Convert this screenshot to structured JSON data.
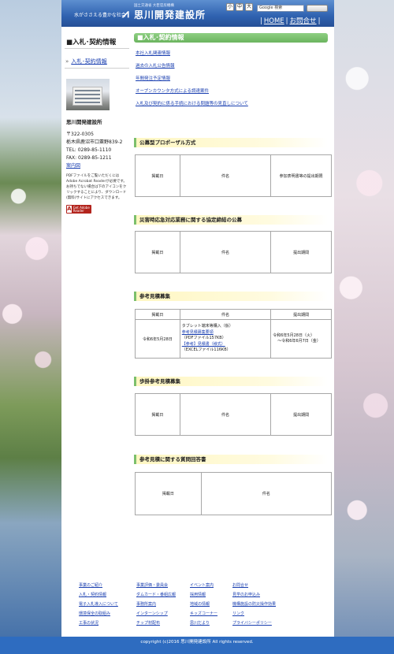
{
  "header": {
    "tagline": "水がささえる豊かな社会",
    "org_parent": "国土交通省 大臣官房機構",
    "org_name": "思川開発建設所",
    "org_sub": "川の防災事業・環境をうちに生まれる水 思川開発",
    "font_size_buttons": [
      "小",
      "中",
      "大"
    ],
    "search_placeholder": "Google 検索",
    "search_button": "",
    "nav": [
      "HOME",
      "お問合せ"
    ]
  },
  "sidebar": {
    "title": "■入札･契約情報",
    "link": "入札･契約情報",
    "office_name": "思川開発建設所",
    "postal": "〒322-0305",
    "address": "栃木県鹿沼市口粟野839-2",
    "tel": "TEL: 0289-85-1110",
    "fax": "FAX: 0289-85-1211",
    "map_link": "案内図",
    "pdf_note": "PDFファイルをご覧いただくにはAdobe Acrobat Readerが必要です。お持ちでない場合は下のアイコンをクリックすることにより、ダウンロード(無料)サイトにアクセスできます。",
    "acrobat_label": "Get Adobe Reader"
  },
  "main": {
    "title": "■入札･契約情報",
    "links": [
      "本社入札関連情報",
      "過去の入札公告情報",
      "年間発注予定情報",
      "オープンカウンタ方式による調達案件",
      "入札及び契約に係る手続における問題等の見直しについて"
    ],
    "sections": [
      {
        "heading": "公募型プロポーザル方式",
        "cols": [
          "掲載日",
          "件名",
          "参加表明書等の提出期限"
        ]
      },
      {
        "heading": "災害時応急対応業務に関する協定締結の公募",
        "cols": [
          "掲載日",
          "件名",
          "提出期間"
        ]
      },
      {
        "heading": "参考見積募集",
        "cols": [
          "掲載日",
          "件名",
          "提出期間"
        ],
        "row": {
          "date": "令和6年5月28日",
          "title": "タブレット端末等購入（仮）",
          "link1": "参考見積募集要領",
          "note1": "（PDFファイル157KB）",
          "link2": "【参考】見積書（様式）",
          "note2": "（EXCELファイル116KB）",
          "period1": "令和6年5月28日（火）",
          "period2": "～令和6年6月7日（金）"
        }
      },
      {
        "heading": "歩掛参考見積募集",
        "cols": [
          "掲載日",
          "件名",
          "提出期間"
        ]
      },
      {
        "heading": "参考見積に関する質問回答書",
        "cols": [
          "掲載日",
          "件名"
        ]
      }
    ]
  },
  "footer": {
    "links": [
      "事業のご紹介",
      "事業評価・委員会",
      "イベント案内",
      "お問合せ",
      "入札・契約情報",
      "ダムカード・番組広報",
      "採用情報",
      "見学のお申込み",
      "電子入札導入について",
      "事務所案内",
      "地域の情報",
      "機構施設の防災操作効果",
      "環境保全の取組み",
      "インターンシップ",
      "キッズコーナー",
      "リンク",
      "工事の状況",
      "チップ材配布",
      "思川だより",
      "プライバシーポリシー"
    ],
    "copyright": "copyright (c)2016 思川開発建設所 All rights reserved."
  }
}
